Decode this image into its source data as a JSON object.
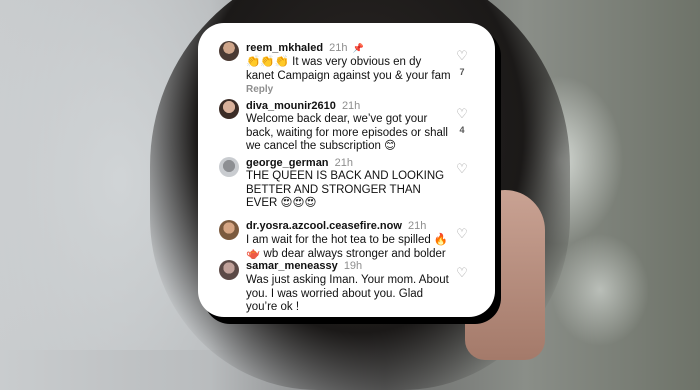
{
  "comments": [
    {
      "username": "reem_mkhaled",
      "time": "21h",
      "pinned_icon": "pin-icon",
      "text": "👏👏👏 It was very obvious en dy kanet Campaign against you & your fam",
      "reply_label": "Reply",
      "likes": "7"
    },
    {
      "username": "diva_mounir2610",
      "time": "21h",
      "text": "Welcome back dear, we’ve got your back, waiting for more episodes or shall we cancel the subscription 😊",
      "likes": "4"
    },
    {
      "username": "george_german",
      "time": "21h",
      "text": "THE QUEEN IS BACK AND LOOKING BETTER AND STRONGER THAN EVER 😍😍😍"
    },
    {
      "username": "dr.yosra.azcool.ceasefire.now",
      "time": "21h",
      "text": "I am wait for the hot tea to be spilled 🔥 🫖 wb dear always stronger and bolder"
    },
    {
      "username": "samar_meneassy",
      "time": "19h",
      "text": "Was just asking Iman. Your mom. About you. I was worried about you. Glad you’re ok !"
    }
  ]
}
